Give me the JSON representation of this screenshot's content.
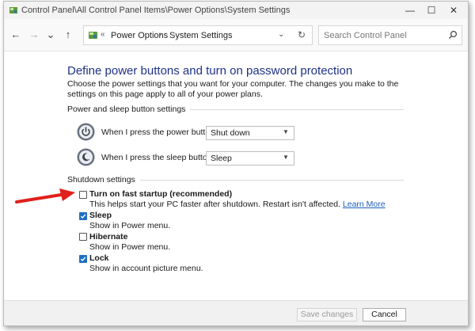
{
  "window": {
    "title": "Control Panel\\All Control Panel Items\\Power Options\\System Settings",
    "controls": {
      "minimize": "—",
      "maximize": "☐",
      "close": "✕"
    }
  },
  "nav": {
    "back": "←",
    "forward": "→",
    "recent": "⌄",
    "up": "↑",
    "address": {
      "overflow": "«",
      "crumbs": [
        "Power Options",
        "System Settings"
      ],
      "separator": "›",
      "dropdown": "⌄",
      "refresh": "↻"
    },
    "search": {
      "placeholder": "Search Control Panel"
    }
  },
  "page": {
    "heading": "Define power buttons and turn on password protection",
    "intro": "Choose the power settings that you want for your computer. The changes you make to the settings on this page apply to all of your power plans.",
    "power_group": {
      "title": "Power and sleep button settings",
      "rows": [
        {
          "label": "When I press the power button:",
          "value": "Shut down",
          "icon": "power-button-icon"
        },
        {
          "label": "When I press the sleep button:",
          "value": "Sleep",
          "icon": "sleep-button-icon"
        }
      ]
    },
    "shutdown_group": {
      "title": "Shutdown settings",
      "options": [
        {
          "label": "Turn on fast startup (recommended)",
          "description": "This helps start your PC faster after shutdown. Restart isn't affected.",
          "link": "Learn More",
          "checked": false
        },
        {
          "label": "Sleep",
          "description": "Show in Power menu.",
          "checked": true
        },
        {
          "label": "Hibernate",
          "description": "Show in Power menu.",
          "checked": false
        },
        {
          "label": "Lock",
          "description": "Show in account picture menu.",
          "checked": true
        }
      ]
    }
  },
  "footer": {
    "save_label": "Save changes",
    "cancel_label": "Cancel"
  },
  "colors": {
    "heading": "#1e3287",
    "link": "#1f5fbf",
    "checkbox_checked": "#1f6fbf",
    "annotation_arrow": "#e0201b"
  },
  "annotation": {
    "icon": "red-arrow-icon"
  }
}
